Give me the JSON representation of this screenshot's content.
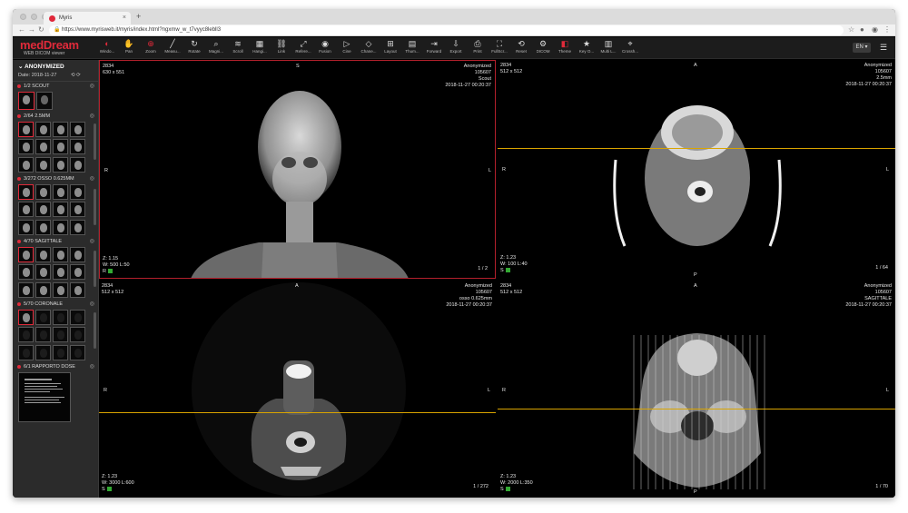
{
  "browser": {
    "tab_title": "Myris",
    "tab_close": "×",
    "new_tab": "+",
    "url": "https://www.myrisweb.it/myris/index.html?ngxmw_w_t7vyyc8lebll3"
  },
  "app": {
    "logo_main": "med",
    "logo_accent": "Dream",
    "logo_sub": "WEB DICOM viewer",
    "language": "EN",
    "toolbar": [
      {
        "label": "Windo...",
        "icon": "window-level-icon",
        "glyph": "◐",
        "red": true
      },
      {
        "label": "Pan",
        "icon": "pan-icon",
        "glyph": "✋",
        "red": true
      },
      {
        "label": "Zoom",
        "icon": "zoom-icon",
        "glyph": "⊕",
        "red": true
      },
      {
        "label": "Measu...",
        "icon": "measure-icon",
        "glyph": "╱",
        "red": false
      },
      {
        "label": "Rotate",
        "icon": "rotate-icon",
        "glyph": "↻",
        "red": false
      },
      {
        "label": "Magni...",
        "icon": "magnifier-icon",
        "glyph": "⌕",
        "red": false
      },
      {
        "label": "Scroll",
        "icon": "scroll-icon",
        "glyph": "≋",
        "red": false
      },
      {
        "label": "Hangi...",
        "icon": "hanging-protocol-icon",
        "glyph": "▦",
        "red": false
      },
      {
        "label": "Link",
        "icon": "link-icon",
        "glyph": "⛓",
        "red": false
      },
      {
        "label": "Refere...",
        "icon": "reference-lines-icon",
        "glyph": "⤢",
        "red": false
      },
      {
        "label": "Fusion",
        "icon": "fusion-icon",
        "glyph": "◉",
        "red": false
      },
      {
        "label": "Cine",
        "icon": "cine-icon",
        "glyph": "▷",
        "red": false
      },
      {
        "label": "Chane...",
        "icon": "change-series-icon",
        "glyph": "◇",
        "red": false
      },
      {
        "label": "Layout",
        "icon": "layout-icon",
        "glyph": "⊞",
        "red": false
      },
      {
        "label": "Thum...",
        "icon": "thumbnails-icon",
        "glyph": "▤",
        "red": false
      },
      {
        "label": "Forward",
        "icon": "forward-icon",
        "glyph": "⇥",
        "red": false
      },
      {
        "label": "Export",
        "icon": "export-icon",
        "glyph": "⇩",
        "red": false
      },
      {
        "label": "Print",
        "icon": "print-icon",
        "glyph": "⎙",
        "red": false
      },
      {
        "label": "FullScr...",
        "icon": "fullscreen-icon",
        "glyph": "⛶",
        "red": false
      },
      {
        "label": "Reset",
        "icon": "reset-icon",
        "glyph": "⟲",
        "red": false
      },
      {
        "label": "DICOM",
        "icon": "dicom-tags-icon",
        "glyph": "⚙",
        "red": false
      },
      {
        "label": "Theme",
        "icon": "theme-icon",
        "glyph": "◧",
        "red": true
      },
      {
        "label": "Key O...",
        "icon": "key-object-icon",
        "glyph": "★",
        "red": false
      },
      {
        "label": "Multi L...",
        "icon": "multi-layout-icon",
        "glyph": "▥",
        "red": false
      },
      {
        "label": "Crossh...",
        "icon": "crosshair-icon",
        "glyph": "⌖",
        "red": false
      }
    ]
  },
  "patient": {
    "name": "ANONYMIZED",
    "date_label": "Date:",
    "date": "2018-11-27"
  },
  "series": [
    {
      "label": "1/2  SCOUT"
    },
    {
      "label": "2/64  2.5MM"
    },
    {
      "label": "3/272  OSSO 0.625MM"
    },
    {
      "label": "4/70  SAGITTALE"
    },
    {
      "label": "5/70  CORONALE"
    },
    {
      "label": "6/1  RAPPORTO DOSE"
    }
  ],
  "viewports": [
    {
      "tl1": "2834",
      "tl2": "630 x 551",
      "tr1": "Anonymized",
      "tr2": "105607",
      "tr3": "Scout",
      "tr4": "2018-11-27 00:20:37",
      "top": "S",
      "left": "R",
      "right": "L",
      "bl1": "Z: 1.15",
      "bl2": "W: 500 L:50",
      "bl3": "R",
      "count": "1 / 2"
    },
    {
      "tl1": "2834",
      "tl2": "512 x 512",
      "tr1": "Anonymized",
      "tr2": "105607",
      "tr3": "2.5mm",
      "tr4": "2018-11-27 00:20:37",
      "top": "A",
      "left": "R",
      "right": "L",
      "bottom": "P",
      "bl1": "Z: 1.23",
      "bl2": "W: 100 L:40",
      "bl3": "S",
      "count": "1 / 64"
    },
    {
      "tl1": "2834",
      "tl2": "512 x 512",
      "tr1": "Anonymized",
      "tr2": "105607",
      "tr3": "osso 0.625mm",
      "tr4": "2018-11-27 00:20:37",
      "top": "A",
      "left": "R",
      "right": "L",
      "bl1": "Z: 1.23",
      "bl2": "W: 3000 L:600",
      "bl3": "S",
      "count": "1 / 272"
    },
    {
      "tl1": "2834",
      "tl2": "512 x 512",
      "tr1": "Anonymized",
      "tr2": "105607",
      "tr3": "SAGITTALE",
      "tr4": "2018-11-27 00:20:37",
      "top": "A",
      "left": "R",
      "right": "L",
      "bottom": "P",
      "bl1": "Z: 1.23",
      "bl2": "W: 2000 L:350",
      "bl3": "S",
      "count": "1 / 70"
    }
  ]
}
